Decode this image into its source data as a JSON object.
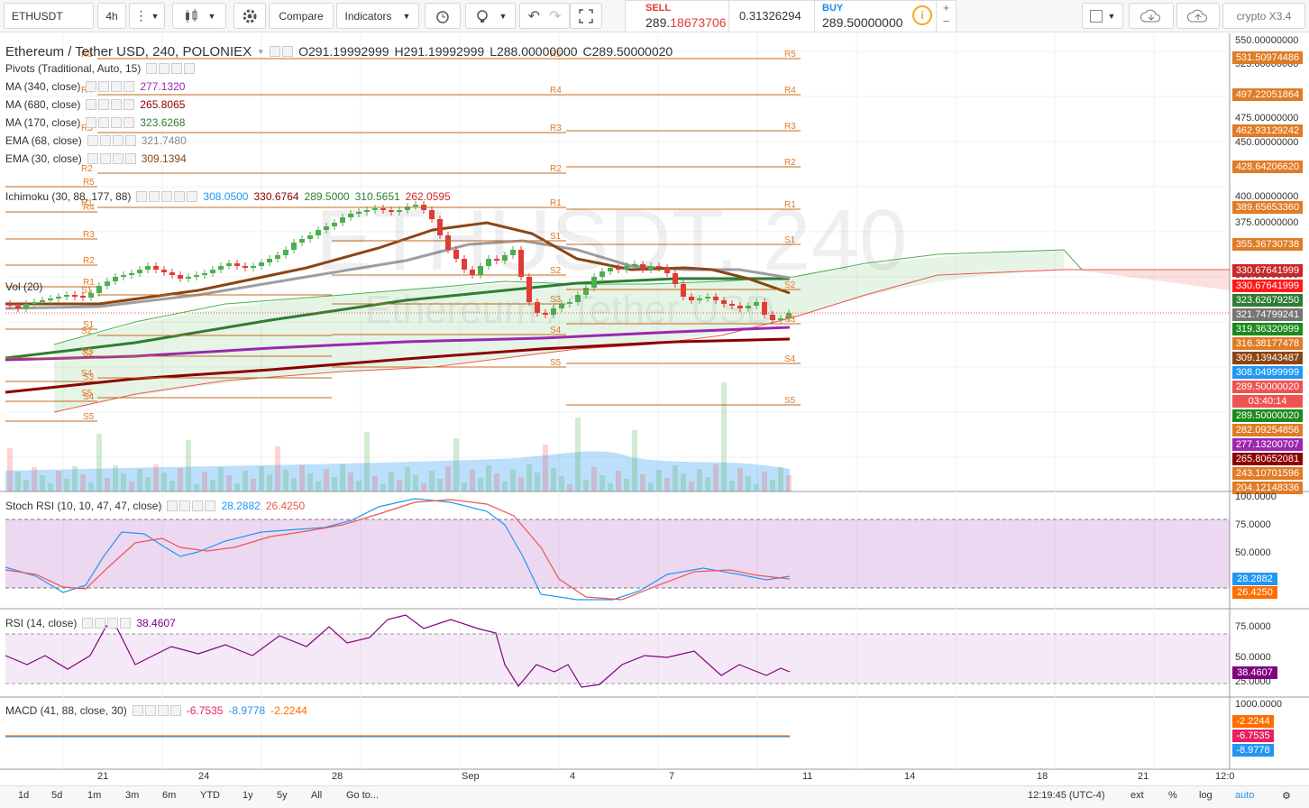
{
  "toolbar": {
    "symbol": "ETHUSDT",
    "interval": "4h",
    "compare_label": "Compare",
    "indicators_label": "Indicators",
    "sell_label": "SELL",
    "sell_price_main": "289.",
    "sell_price_digits": "18673706",
    "spread": "0.31326294",
    "buy_label": "BUY",
    "buy_price": "289.50000000",
    "layout_name": "crypto X3.4"
  },
  "legend": {
    "title": "Ethereum / Tether USD, 240, POLONIEX",
    "ohlc": {
      "o": "O291.19992999",
      "h": "H291.19992999",
      "l": "L288.00000000",
      "c": "C289.50000020"
    },
    "rows": [
      {
        "label": "Pivots (Traditional, Auto, 15)",
        "value": "",
        "color": "#333"
      },
      {
        "label": "MA (340, close)",
        "value": "277.1320",
        "color": "#9c27b0"
      },
      {
        "label": "MA (680, close)",
        "value": "265.8065",
        "color": "#8b0000"
      },
      {
        "label": "MA (170, close)",
        "value": "323.6268",
        "color": "#2e7d32"
      },
      {
        "label": "EMA (68, close)",
        "value": "321.7480",
        "color": "#888"
      },
      {
        "label": "EMA (30, close)",
        "value": "309.1394",
        "color": "#8b4513"
      }
    ],
    "ichimoku": {
      "label": "Ichimoku (30, 88, 177, 88)",
      "v1": "308.0500",
      "v2": "330.6764",
      "v3": "289.5000",
      "v4": "310.5651",
      "v5": "262.0595"
    },
    "vol": "Vol (20)",
    "stoch": {
      "label": "Stoch RSI (10, 10, 47, 47, close)",
      "k": "28.2882",
      "d": "26.4250"
    },
    "rsi": {
      "label": "RSI (14, close)",
      "value": "38.4607"
    },
    "macd": {
      "label": "MACD (41, 88, close, 30)",
      "v1": "-6.7535",
      "v2": "-8.9778",
      "v3": "-2.2244"
    }
  },
  "watermark": {
    "symbol": "ETHUSDT, 240",
    "name": "Ethereum / Tether USD"
  },
  "price_axis": {
    "ticks": [
      "550.00000000",
      "525.00000000",
      "475.00000000",
      "450.00000000",
      "425.00000000",
      "400.00000000",
      "375.00000000",
      "350.00000000",
      "300.00000000"
    ],
    "labels": [
      {
        "text": "531.50974486",
        "color": "#e07b26"
      },
      {
        "text": "497.22051864",
        "color": "#e07b26"
      },
      {
        "text": "462.93129242",
        "color": "#e07b26"
      },
      {
        "text": "428.64206620",
        "color": "#e07b26"
      },
      {
        "text": "389.65653360",
        "color": "#e07b26"
      },
      {
        "text": "355.36730738",
        "color": "#e07b26"
      },
      {
        "text": "330.67641999",
        "color": "#c62828"
      },
      {
        "text": "330.67641999",
        "color": "#ff1a1a"
      },
      {
        "text": "323.62679250",
        "color": "#2e7d32"
      },
      {
        "text": "321.74799241",
        "color": "#757575"
      },
      {
        "text": "319.36320999",
        "color": "#1b8a1b"
      },
      {
        "text": "316.38177478",
        "color": "#e07b26"
      },
      {
        "text": "309.13943487",
        "color": "#8b4513"
      },
      {
        "text": "308.04999999",
        "color": "#2196f3"
      },
      {
        "text": "289.50000020",
        "color": "#ef5350"
      },
      {
        "text": "03:40:14",
        "color": "#ef5350"
      },
      {
        "text": "289.50000020",
        "color": "#1b8a1b"
      },
      {
        "text": "282.09254856",
        "color": "#e07b26"
      },
      {
        "text": "277.13200707",
        "color": "#9c27b0"
      },
      {
        "text": "265.80652081",
        "color": "#8b0000"
      },
      {
        "text": "243.10701596",
        "color": "#e07b26"
      },
      {
        "text": "204.12148336",
        "color": "#e07b26"
      }
    ],
    "stoch_ticks": [
      "100.0000",
      "75.0000",
      "50.0000"
    ],
    "rsi_ticks": [
      "75.0000",
      "50.0000",
      "25.0000"
    ],
    "macd_ticks": [
      "1000.0000"
    ],
    "macd_labels": [
      {
        "text": "-2.2244",
        "color": "#ff6d00"
      },
      {
        "text": "-6.7535",
        "color": "#e91e63"
      },
      {
        "text": "-8.9778",
        "color": "#2196f3"
      }
    ]
  },
  "pivot_labels": [
    "R5",
    "R4",
    "R3",
    "R2",
    "R1",
    "S1",
    "S2",
    "S3",
    "S4",
    "S5"
  ],
  "time_axis": [
    "21",
    "24",
    "28",
    "Sep",
    "4",
    "7",
    "11",
    "14",
    "18",
    "21",
    "12:0"
  ],
  "bottom_bar": {
    "ranges": [
      "1d",
      "5d",
      "1m",
      "3m",
      "6m",
      "YTD",
      "1y",
      "5y",
      "All",
      "Go to..."
    ],
    "clock": "12:19:45 (UTC-4)",
    "ext": "ext",
    "percent": "%",
    "log": "log",
    "auto": "auto"
  }
}
